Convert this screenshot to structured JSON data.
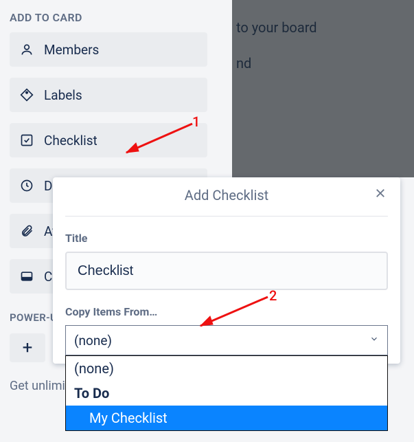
{
  "sidebar": {
    "section_title": "ADD TO CARD",
    "items": [
      {
        "label": "Members"
      },
      {
        "label": "Labels"
      },
      {
        "label": "Checklist"
      },
      {
        "label": "Dates"
      },
      {
        "label": "Attachment"
      },
      {
        "label": "Cover"
      }
    ],
    "powerups_title": "POWER-UPS",
    "get_unlimited": "Get unlimited Power-Ups"
  },
  "background": {
    "line1": "to your board",
    "line2": "nd"
  },
  "popover": {
    "title": "Add Checklist",
    "title_label": "Title",
    "title_value": "Checklist",
    "copy_label": "Copy Items From…",
    "select_value": "(none)",
    "options": [
      {
        "label": "(none)",
        "bold": false,
        "selected": false
      },
      {
        "label": "To Do",
        "bold": true,
        "selected": false
      },
      {
        "label": "My Checklist",
        "bold": false,
        "selected": true
      }
    ]
  },
  "annotations": {
    "one": "1",
    "two": "2"
  }
}
